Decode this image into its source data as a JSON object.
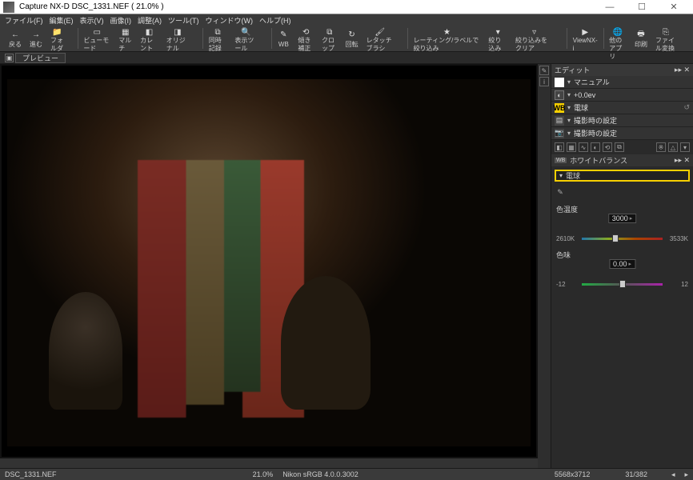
{
  "app_name": "Capture NX-D",
  "doc_name": "DSC_1331.NEF",
  "zoom_pct": "21.0%",
  "title_full": "Capture NX-D    DSC_1331.NEF ( 21.0% )",
  "window_buttons": {
    "min": "—",
    "max": "☐",
    "close": "✕"
  },
  "menu": [
    "ファイル(F)",
    "編集(E)",
    "表示(V)",
    "画像(I)",
    "調整(A)",
    "ツール(T)",
    "ウィンドウ(W)",
    "ヘルプ(H)"
  ],
  "toolbar": {
    "back": "戻る",
    "forward": "進む",
    "folder": "フォルダー",
    "viewer": "ビューモード",
    "multi": "マルチ",
    "current": "カレント",
    "original": "オリジナル",
    "simrec": "同時記録",
    "disptool": "表示ツール",
    "wb": "WB",
    "tilt": "傾き補正",
    "crop": "クロップ",
    "rotate": "回転",
    "retouch": "レタッチブラシ",
    "rating": "レーティング/ラベルで絞り込み",
    "filter": "絞り込み",
    "clearfilter": "絞り込みをクリア",
    "viewnxi": "ViewNX-i",
    "otherapp": "他のアプリ",
    "print": "印刷",
    "convert": "ファイル変換"
  },
  "preview_tab": "プレビュー",
  "edit": {
    "panel_title": "エディット",
    "rows": [
      {
        "icon": "hist",
        "label": "マニュアル"
      },
      {
        "icon": "ev",
        "label": "+0.0ev"
      },
      {
        "icon": "wb",
        "label": "電球",
        "icon_text": "WB"
      },
      {
        "icon": "cam",
        "label": "撮影時の設定"
      },
      {
        "icon": "cam",
        "label": "撮影時の設定"
      }
    ],
    "wb_sect_title": "ホワイトバランス",
    "wb_sect_badge": "WB",
    "wb_value": "電球",
    "temp_label": "色温度",
    "temp_min": "2610K",
    "temp_max": "3533K",
    "temp_val": "3000",
    "tint_label": "色味",
    "tint_min": "-12",
    "tint_max": "12",
    "tint_val": "0.00"
  },
  "status": {
    "file": "DSC_1331.NEF",
    "zoom": "21.0%",
    "profile": "Nikon sRGB 4.0.0.3002",
    "dims": "5568x3712",
    "index": "31/382"
  }
}
